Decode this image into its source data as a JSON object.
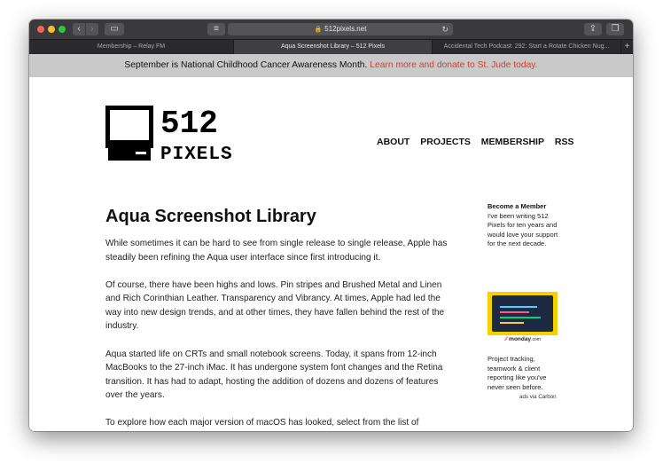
{
  "browser": {
    "url": "512pixels.net",
    "tabs": [
      {
        "label": "Membership – Relay FM"
      },
      {
        "label": "Aqua Screenshot Library – 512 Pixels"
      },
      {
        "label": "Accidental Tech Podcast: 292: Start a Rotate Chicken Nug..."
      }
    ],
    "icons": {
      "back": "‹",
      "forward": "›",
      "sidebar": "▭",
      "reader": "≡",
      "lock": "🔒",
      "reload": "↻",
      "share": "⇪",
      "tabs": "❐",
      "new_tab": "+"
    }
  },
  "banner": {
    "text": "September is National Childhood Cancer Awareness Month. ",
    "link": "Learn more and donate to St. Jude today."
  },
  "site": {
    "logo_text": [
      "512",
      "PIXELS"
    ],
    "nav": [
      "ABOUT",
      "PROJECTS",
      "MEMBERSHIP",
      "RSS"
    ]
  },
  "article": {
    "title": "Aqua Screenshot Library",
    "paragraphs": [
      "While sometimes it can be hard to see from single release to single release, Apple has steadily been refining the Aqua user interface since first introducing it.",
      "Of course, there have been highs and lows. Pin stripes and Brushed Metal and Linen and Rich Corinthian Leather. Transparency and Vibrancy. At times, Apple had led the way into new design trends, and at other times, they have fallen behind the rest of the industry.",
      "Aqua started life on CRTs and small notebook screens. Today, it spans from 12-inch MacBooks to the 27-inch iMac. It has undergone system font changes and the Retina transition. It has had to adapt, hosting the addition of dozens and dozens of features over the years.",
      "To explore how each major version of macOS has looked, select from the list of releases below:"
    ]
  },
  "sidebar": {
    "member_title": "Become a Member",
    "member_text": "I've been writing 512 Pixels for ten years and would love your support for the next decade.",
    "ad_brand": "monday",
    "ad_brand_suffix": ".com",
    "ad_text": "Project tracking, teamwork & client reporting like you've never seen before.",
    "ad_via": "ads via Carbon"
  },
  "colors": {
    "banner_link": "#d9392b",
    "banner_bg": "#c9c9c9",
    "toolbar_bg": "#3a3a3c",
    "ad_bg": "#f3d200"
  }
}
